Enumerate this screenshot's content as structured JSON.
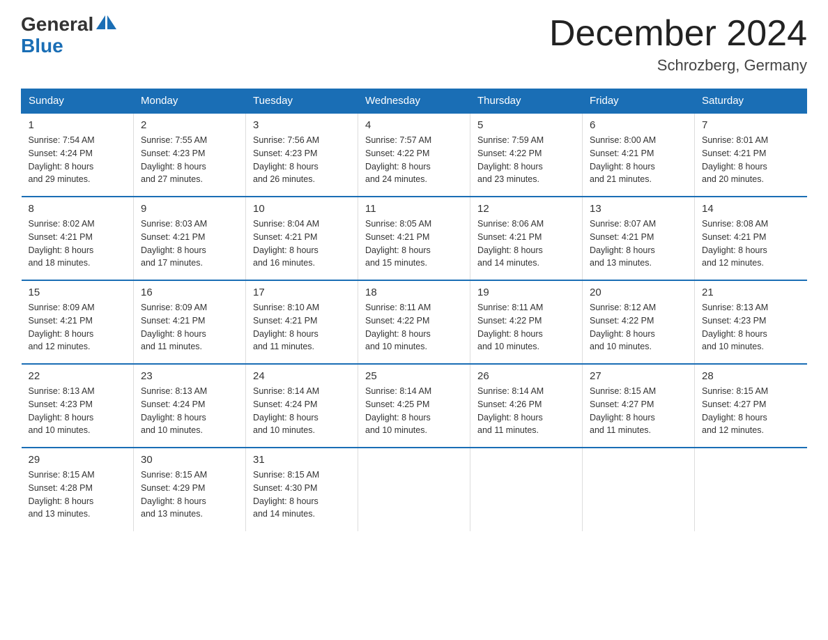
{
  "logo": {
    "text_general": "General",
    "text_blue": "Blue"
  },
  "title": {
    "month_year": "December 2024",
    "location": "Schrozberg, Germany"
  },
  "header_days": [
    "Sunday",
    "Monday",
    "Tuesday",
    "Wednesday",
    "Thursday",
    "Friday",
    "Saturday"
  ],
  "weeks": [
    [
      {
        "day": "1",
        "sunrise": "7:54 AM",
        "sunset": "4:24 PM",
        "daylight": "8 hours and 29 minutes."
      },
      {
        "day": "2",
        "sunrise": "7:55 AM",
        "sunset": "4:23 PM",
        "daylight": "8 hours and 27 minutes."
      },
      {
        "day": "3",
        "sunrise": "7:56 AM",
        "sunset": "4:23 PM",
        "daylight": "8 hours and 26 minutes."
      },
      {
        "day": "4",
        "sunrise": "7:57 AM",
        "sunset": "4:22 PM",
        "daylight": "8 hours and 24 minutes."
      },
      {
        "day": "5",
        "sunrise": "7:59 AM",
        "sunset": "4:22 PM",
        "daylight": "8 hours and 23 minutes."
      },
      {
        "day": "6",
        "sunrise": "8:00 AM",
        "sunset": "4:21 PM",
        "daylight": "8 hours and 21 minutes."
      },
      {
        "day": "7",
        "sunrise": "8:01 AM",
        "sunset": "4:21 PM",
        "daylight": "8 hours and 20 minutes."
      }
    ],
    [
      {
        "day": "8",
        "sunrise": "8:02 AM",
        "sunset": "4:21 PM",
        "daylight": "8 hours and 18 minutes."
      },
      {
        "day": "9",
        "sunrise": "8:03 AM",
        "sunset": "4:21 PM",
        "daylight": "8 hours and 17 minutes."
      },
      {
        "day": "10",
        "sunrise": "8:04 AM",
        "sunset": "4:21 PM",
        "daylight": "8 hours and 16 minutes."
      },
      {
        "day": "11",
        "sunrise": "8:05 AM",
        "sunset": "4:21 PM",
        "daylight": "8 hours and 15 minutes."
      },
      {
        "day": "12",
        "sunrise": "8:06 AM",
        "sunset": "4:21 PM",
        "daylight": "8 hours and 14 minutes."
      },
      {
        "day": "13",
        "sunrise": "8:07 AM",
        "sunset": "4:21 PM",
        "daylight": "8 hours and 13 minutes."
      },
      {
        "day": "14",
        "sunrise": "8:08 AM",
        "sunset": "4:21 PM",
        "daylight": "8 hours and 12 minutes."
      }
    ],
    [
      {
        "day": "15",
        "sunrise": "8:09 AM",
        "sunset": "4:21 PM",
        "daylight": "8 hours and 12 minutes."
      },
      {
        "day": "16",
        "sunrise": "8:09 AM",
        "sunset": "4:21 PM",
        "daylight": "8 hours and 11 minutes."
      },
      {
        "day": "17",
        "sunrise": "8:10 AM",
        "sunset": "4:21 PM",
        "daylight": "8 hours and 11 minutes."
      },
      {
        "day": "18",
        "sunrise": "8:11 AM",
        "sunset": "4:22 PM",
        "daylight": "8 hours and 10 minutes."
      },
      {
        "day": "19",
        "sunrise": "8:11 AM",
        "sunset": "4:22 PM",
        "daylight": "8 hours and 10 minutes."
      },
      {
        "day": "20",
        "sunrise": "8:12 AM",
        "sunset": "4:22 PM",
        "daylight": "8 hours and 10 minutes."
      },
      {
        "day": "21",
        "sunrise": "8:13 AM",
        "sunset": "4:23 PM",
        "daylight": "8 hours and 10 minutes."
      }
    ],
    [
      {
        "day": "22",
        "sunrise": "8:13 AM",
        "sunset": "4:23 PM",
        "daylight": "8 hours and 10 minutes."
      },
      {
        "day": "23",
        "sunrise": "8:13 AM",
        "sunset": "4:24 PM",
        "daylight": "8 hours and 10 minutes."
      },
      {
        "day": "24",
        "sunrise": "8:14 AM",
        "sunset": "4:24 PM",
        "daylight": "8 hours and 10 minutes."
      },
      {
        "day": "25",
        "sunrise": "8:14 AM",
        "sunset": "4:25 PM",
        "daylight": "8 hours and 10 minutes."
      },
      {
        "day": "26",
        "sunrise": "8:14 AM",
        "sunset": "4:26 PM",
        "daylight": "8 hours and 11 minutes."
      },
      {
        "day": "27",
        "sunrise": "8:15 AM",
        "sunset": "4:27 PM",
        "daylight": "8 hours and 11 minutes."
      },
      {
        "day": "28",
        "sunrise": "8:15 AM",
        "sunset": "4:27 PM",
        "daylight": "8 hours and 12 minutes."
      }
    ],
    [
      {
        "day": "29",
        "sunrise": "8:15 AM",
        "sunset": "4:28 PM",
        "daylight": "8 hours and 13 minutes."
      },
      {
        "day": "30",
        "sunrise": "8:15 AM",
        "sunset": "4:29 PM",
        "daylight": "8 hours and 13 minutes."
      },
      {
        "day": "31",
        "sunrise": "8:15 AM",
        "sunset": "4:30 PM",
        "daylight": "8 hours and 14 minutes."
      },
      null,
      null,
      null,
      null
    ]
  ],
  "labels": {
    "sunrise": "Sunrise:",
    "sunset": "Sunset:",
    "daylight": "Daylight:"
  }
}
